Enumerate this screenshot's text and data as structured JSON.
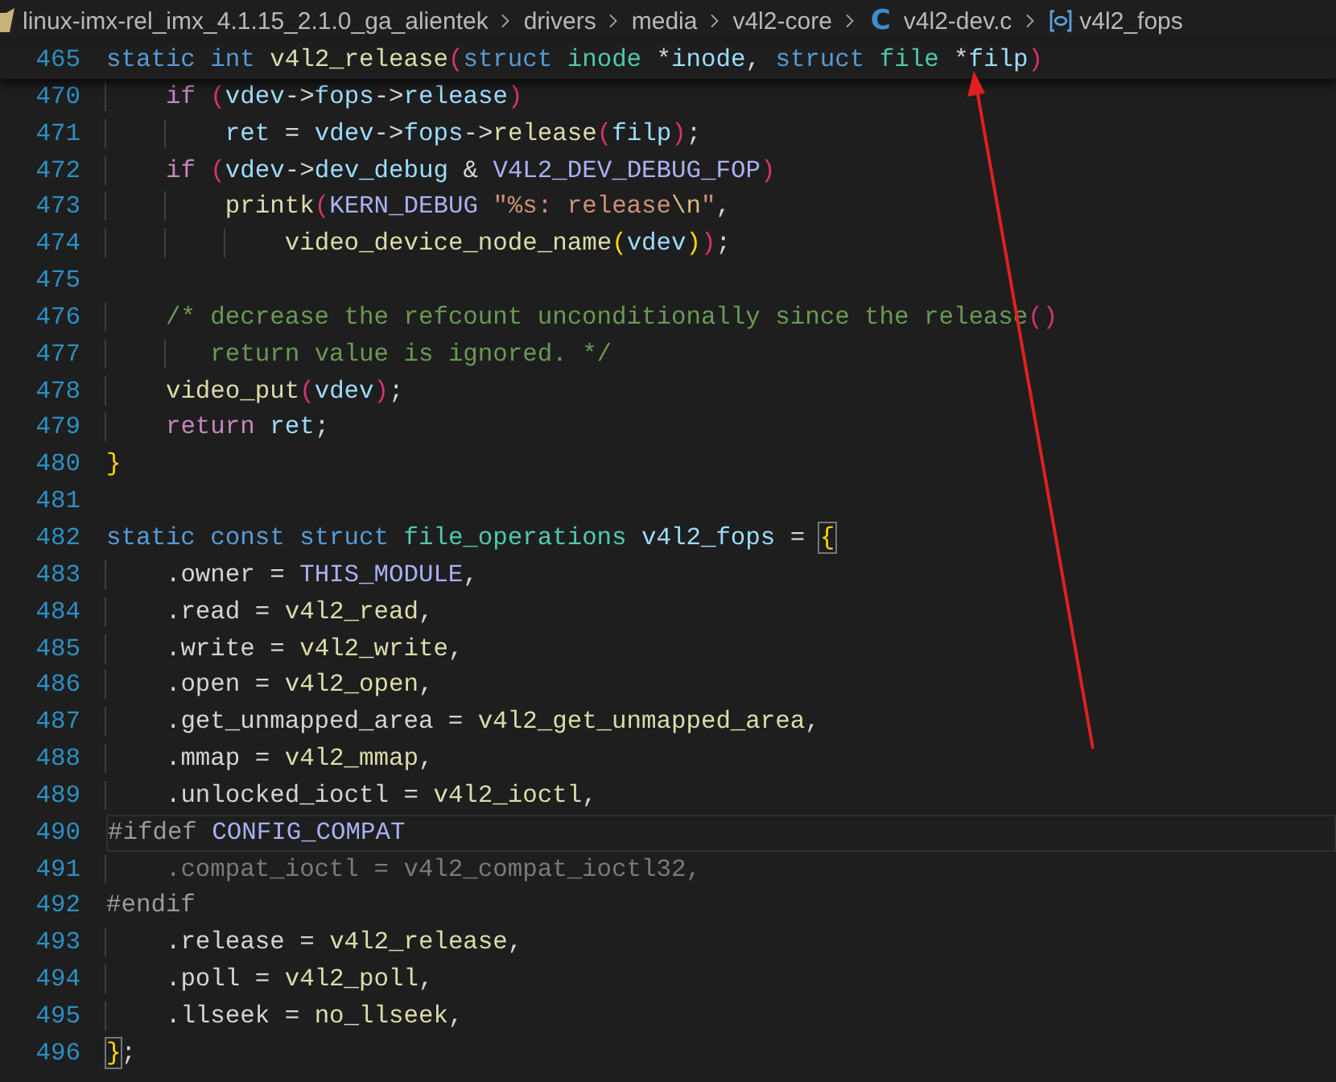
{
  "breadcrumbs": [
    {
      "kind": "root",
      "label": "linux-imx-rel_imx_4.1.15_2.1.0_ga_alientek"
    },
    {
      "kind": "folder",
      "label": "drivers"
    },
    {
      "kind": "folder",
      "label": "media"
    },
    {
      "kind": "folder",
      "label": "v4l2-core"
    },
    {
      "kind": "file",
      "icon": "C",
      "label": "v4l2-dev.c"
    },
    {
      "kind": "symbol",
      "label": "v4l2_fops"
    }
  ],
  "sticky_line": {
    "number": "465",
    "tokens": [
      {
        "kind": "kw",
        "text": "static "
      },
      {
        "kind": "kw",
        "text": "int "
      },
      {
        "kind": "fn",
        "text": "v4l2_release"
      },
      {
        "kind": "p1",
        "text": "("
      },
      {
        "kind": "kw",
        "text": "struct "
      },
      {
        "kind": "type",
        "text": "inode "
      },
      {
        "kind": "plain",
        "text": "*"
      },
      {
        "kind": "var",
        "text": "inode"
      },
      {
        "kind": "plain",
        "text": ", "
      },
      {
        "kind": "kw",
        "text": "struct "
      },
      {
        "kind": "type",
        "text": "file "
      },
      {
        "kind": "plain",
        "text": "*"
      },
      {
        "kind": "var",
        "text": "filp"
      },
      {
        "kind": "p1",
        "text": ")"
      }
    ]
  },
  "lines": [
    {
      "number": "470",
      "current": false,
      "tokens": [
        {
          "kind": "ctl",
          "text": "    if "
        },
        {
          "kind": "p1",
          "text": "("
        },
        {
          "kind": "var",
          "text": "vdev"
        },
        {
          "kind": "plain",
          "text": "->"
        },
        {
          "kind": "var",
          "text": "fops"
        },
        {
          "kind": "plain",
          "text": "->"
        },
        {
          "kind": "var",
          "text": "release"
        },
        {
          "kind": "p1",
          "text": ")"
        }
      ]
    },
    {
      "number": "471",
      "current": false,
      "tokens": [
        {
          "kind": "var",
          "text": "        ret"
        },
        {
          "kind": "plain",
          "text": " = "
        },
        {
          "kind": "var",
          "text": "vdev"
        },
        {
          "kind": "plain",
          "text": "->"
        },
        {
          "kind": "var",
          "text": "fops"
        },
        {
          "kind": "plain",
          "text": "->"
        },
        {
          "kind": "fn",
          "text": "release"
        },
        {
          "kind": "p1",
          "text": "("
        },
        {
          "kind": "var",
          "text": "filp"
        },
        {
          "kind": "p1",
          "text": ")"
        },
        {
          "kind": "plain",
          "text": ";"
        }
      ]
    },
    {
      "number": "472",
      "current": false,
      "tokens": [
        {
          "kind": "ctl",
          "text": "    if "
        },
        {
          "kind": "p1",
          "text": "("
        },
        {
          "kind": "var",
          "text": "vdev"
        },
        {
          "kind": "plain",
          "text": "->"
        },
        {
          "kind": "var",
          "text": "dev_debug"
        },
        {
          "kind": "plain",
          "text": " & "
        },
        {
          "kind": "macro",
          "text": "V4L2_DEV_DEBUG_FOP"
        },
        {
          "kind": "p1",
          "text": ")"
        }
      ]
    },
    {
      "number": "473",
      "current": false,
      "tokens": [
        {
          "kind": "fn",
          "text": "        printk"
        },
        {
          "kind": "p1",
          "text": "("
        },
        {
          "kind": "macro",
          "text": "KERN_DEBUG "
        },
        {
          "kind": "str",
          "text": "\"%s: release"
        },
        {
          "kind": "esc",
          "text": "\\n"
        },
        {
          "kind": "str",
          "text": "\""
        },
        {
          "kind": "plain",
          "text": ","
        }
      ]
    },
    {
      "number": "474",
      "current": false,
      "tokens": [
        {
          "kind": "fn",
          "text": "            video_device_node_name"
        },
        {
          "kind": "p2",
          "text": "("
        },
        {
          "kind": "var",
          "text": "vdev"
        },
        {
          "kind": "p2",
          "text": ")"
        },
        {
          "kind": "p1",
          "text": ")"
        },
        {
          "kind": "plain",
          "text": ";"
        }
      ]
    },
    {
      "number": "475",
      "current": false
    },
    {
      "number": "476",
      "current": false,
      "tokens": [
        {
          "kind": "cmt",
          "text": "    /* decrease the refcount unconditionally since the release"
        },
        {
          "kind": "p1",
          "text": "()"
        }
      ]
    },
    {
      "number": "477",
      "current": false,
      "tokens": [
        {
          "kind": "cmt",
          "text": "       return value is ignored. */"
        }
      ]
    },
    {
      "number": "478",
      "current": false,
      "tokens": [
        {
          "kind": "fn",
          "text": "    video_put"
        },
        {
          "kind": "p1",
          "text": "("
        },
        {
          "kind": "var",
          "text": "vdev"
        },
        {
          "kind": "p1",
          "text": ")"
        },
        {
          "kind": "plain",
          "text": ";"
        }
      ]
    },
    {
      "number": "479",
      "current": false,
      "tokens": [
        {
          "kind": "ctl",
          "text": "    return "
        },
        {
          "kind": "var",
          "text": "ret"
        },
        {
          "kind": "plain",
          "text": ";"
        }
      ]
    },
    {
      "number": "480",
      "current": false,
      "tokens": [
        {
          "kind": "p2",
          "text": "}"
        }
      ]
    },
    {
      "number": "481",
      "current": false
    },
    {
      "number": "482",
      "current": false,
      "tokens": [
        {
          "kind": "kw",
          "text": "static "
        },
        {
          "kind": "kw",
          "text": "const "
        },
        {
          "kind": "kw",
          "text": "struct "
        },
        {
          "kind": "type",
          "text": "file_operations "
        },
        {
          "kind": "var",
          "text": "v4l2_fops"
        },
        {
          "kind": "plain",
          "text": " = "
        },
        {
          "kind": "brace",
          "text": "{"
        }
      ]
    },
    {
      "number": "483",
      "current": false,
      "tokens": [
        {
          "kind": "plain",
          "text": "    .owner = "
        },
        {
          "kind": "macro",
          "text": "THIS_MODULE"
        },
        {
          "kind": "plain",
          "text": ","
        }
      ]
    },
    {
      "number": "484",
      "current": false,
      "tokens": [
        {
          "kind": "plain",
          "text": "    .read = "
        },
        {
          "kind": "fn",
          "text": "v4l2_read"
        },
        {
          "kind": "plain",
          "text": ","
        }
      ]
    },
    {
      "number": "485",
      "current": false,
      "tokens": [
        {
          "kind": "plain",
          "text": "    .write = "
        },
        {
          "kind": "fn",
          "text": "v4l2_write"
        },
        {
          "kind": "plain",
          "text": ","
        }
      ]
    },
    {
      "number": "486",
      "current": false,
      "tokens": [
        {
          "kind": "plain",
          "text": "    .open = "
        },
        {
          "kind": "fn",
          "text": "v4l2_open"
        },
        {
          "kind": "plain",
          "text": ","
        }
      ]
    },
    {
      "number": "487",
      "current": false,
      "tokens": [
        {
          "kind": "plain",
          "text": "    .get_unmapped_area = "
        },
        {
          "kind": "fn",
          "text": "v4l2_get_unmapped_area"
        },
        {
          "kind": "plain",
          "text": ","
        }
      ]
    },
    {
      "number": "488",
      "current": false,
      "tokens": [
        {
          "kind": "plain",
          "text": "    .mmap = "
        },
        {
          "kind": "fn",
          "text": "v4l2_mmap"
        },
        {
          "kind": "plain",
          "text": ","
        }
      ]
    },
    {
      "number": "489",
      "current": false,
      "tokens": [
        {
          "kind": "plain",
          "text": "    .unlocked_ioctl = "
        },
        {
          "kind": "fn",
          "text": "v4l2_ioctl"
        },
        {
          "kind": "plain",
          "text": ","
        }
      ]
    },
    {
      "number": "490",
      "current": true,
      "tokens": [
        {
          "kind": "pre",
          "text": "#ifdef "
        },
        {
          "kind": "macro",
          "text": "CONFIG_COMPAT"
        }
      ]
    },
    {
      "number": "491",
      "current": false,
      "tokens": [
        {
          "kind": "inactive",
          "text": "    .compat_ioctl = v4l2_compat_ioctl32,"
        }
      ]
    },
    {
      "number": "492",
      "current": false,
      "tokens": [
        {
          "kind": "pre",
          "text": "#endif"
        }
      ]
    },
    {
      "number": "493",
      "current": false,
      "tokens": [
        {
          "kind": "plain",
          "text": "    .release = "
        },
        {
          "kind": "fn",
          "text": "v4l2_release"
        },
        {
          "kind": "plain",
          "text": ","
        }
      ]
    },
    {
      "number": "494",
      "current": false,
      "tokens": [
        {
          "kind": "plain",
          "text": "    .poll = "
        },
        {
          "kind": "fn",
          "text": "v4l2_poll"
        },
        {
          "kind": "plain",
          "text": ","
        }
      ]
    },
    {
      "number": "495",
      "current": false,
      "tokens": [
        {
          "kind": "plain",
          "text": "    .llseek = "
        },
        {
          "kind": "fn",
          "text": "no_llseek"
        },
        {
          "kind": "plain",
          "text": ","
        }
      ]
    },
    {
      "number": "496",
      "current": false,
      "tokens": [
        {
          "kind": "brace",
          "text": "}"
        },
        {
          "kind": "plain",
          "text": ";"
        }
      ]
    }
  ]
}
